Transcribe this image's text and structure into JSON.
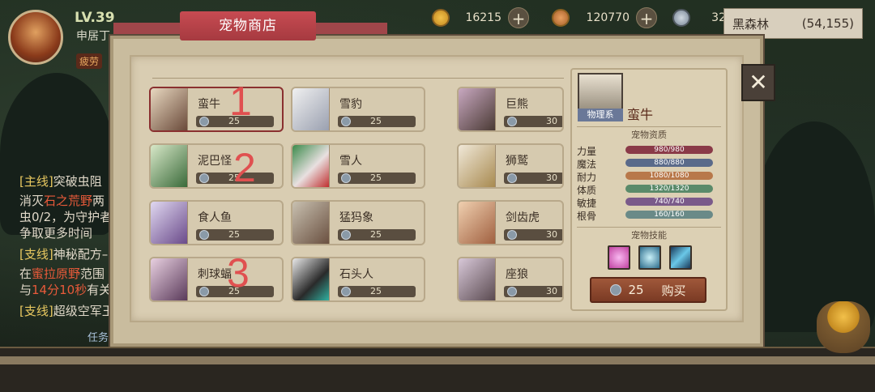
{
  "player": {
    "level": "LV.39",
    "location": "申居丁",
    "status": "疲劳"
  },
  "resources": [
    {
      "icon": "gold-coin-icon",
      "value": "16215"
    },
    {
      "icon": "bronze-coin-icon",
      "value": "120770"
    },
    {
      "icon": "silver-coin-icon",
      "value": "32"
    }
  ],
  "map": {
    "name": "黑森林",
    "coords": "(54,155)"
  },
  "quests": {
    "q1_tag": "[主线]",
    "q1_title": "突破虫阻",
    "q1_l1a": "消灭",
    "q1_l1b": "石之荒野",
    "q1_l1c": "两",
    "q1_l2": "虫0/2，为守护者",
    "q1_l3": "争取更多时间",
    "q2_tag": "[支线]",
    "q2_title": "神秘配方–",
    "q2_l1a": "在",
    "q2_l1b": "蜜拉原野",
    "q2_l1c": "范围",
    "q2_l2a": "与",
    "q2_l2b": "14分10秒",
    "q2_l2c": "有关",
    "q3_tag": "[支线]",
    "q3_title": "超级空军王",
    "bottom_tab": "任务"
  },
  "shop": {
    "title": "宠物商店",
    "close": "✕",
    "pets": [
      {
        "name": "蛮牛",
        "price": "25"
      },
      {
        "name": "雪豹",
        "price": "25"
      },
      {
        "name": "巨熊",
        "price": "30"
      },
      {
        "name": "泥巴怪",
        "price": "25"
      },
      {
        "name": "雪人",
        "price": "25"
      },
      {
        "name": "狮鹫",
        "price": "30"
      },
      {
        "name": "食人鱼",
        "price": "25"
      },
      {
        "name": "猛犸象",
        "price": "25"
      },
      {
        "name": "剑齿虎",
        "price": "30"
      },
      {
        "name": "刺球蝠",
        "price": "25"
      },
      {
        "name": "石头人",
        "price": "25"
      },
      {
        "name": "座狼",
        "price": "30"
      }
    ],
    "annotations": [
      "1",
      "2",
      "3"
    ]
  },
  "detail": {
    "type": "物理系",
    "name": "蛮牛",
    "aptitude_title": "宠物资质",
    "stats": [
      {
        "label": "力量",
        "value": "980/980",
        "color": "#8a3a48"
      },
      {
        "label": "魔法",
        "value": "880/880",
        "color": "#5a6a8a"
      },
      {
        "label": "耐力",
        "value": "1080/1080",
        "color": "#b8784a"
      },
      {
        "label": "体质",
        "value": "1320/1320",
        "color": "#5a8a6a"
      },
      {
        "label": "敏捷",
        "value": "740/740",
        "color": "#7a5a8a"
      },
      {
        "label": "根骨",
        "value": "160/160",
        "color": "#6a8a88"
      }
    ],
    "skills_title": "宠物技能",
    "skills": [
      "pink-burst-skill-icon",
      "ice-crystal-skill-icon",
      "wind-slash-skill-icon"
    ],
    "buy_price": "25",
    "buy_label": "购买"
  }
}
